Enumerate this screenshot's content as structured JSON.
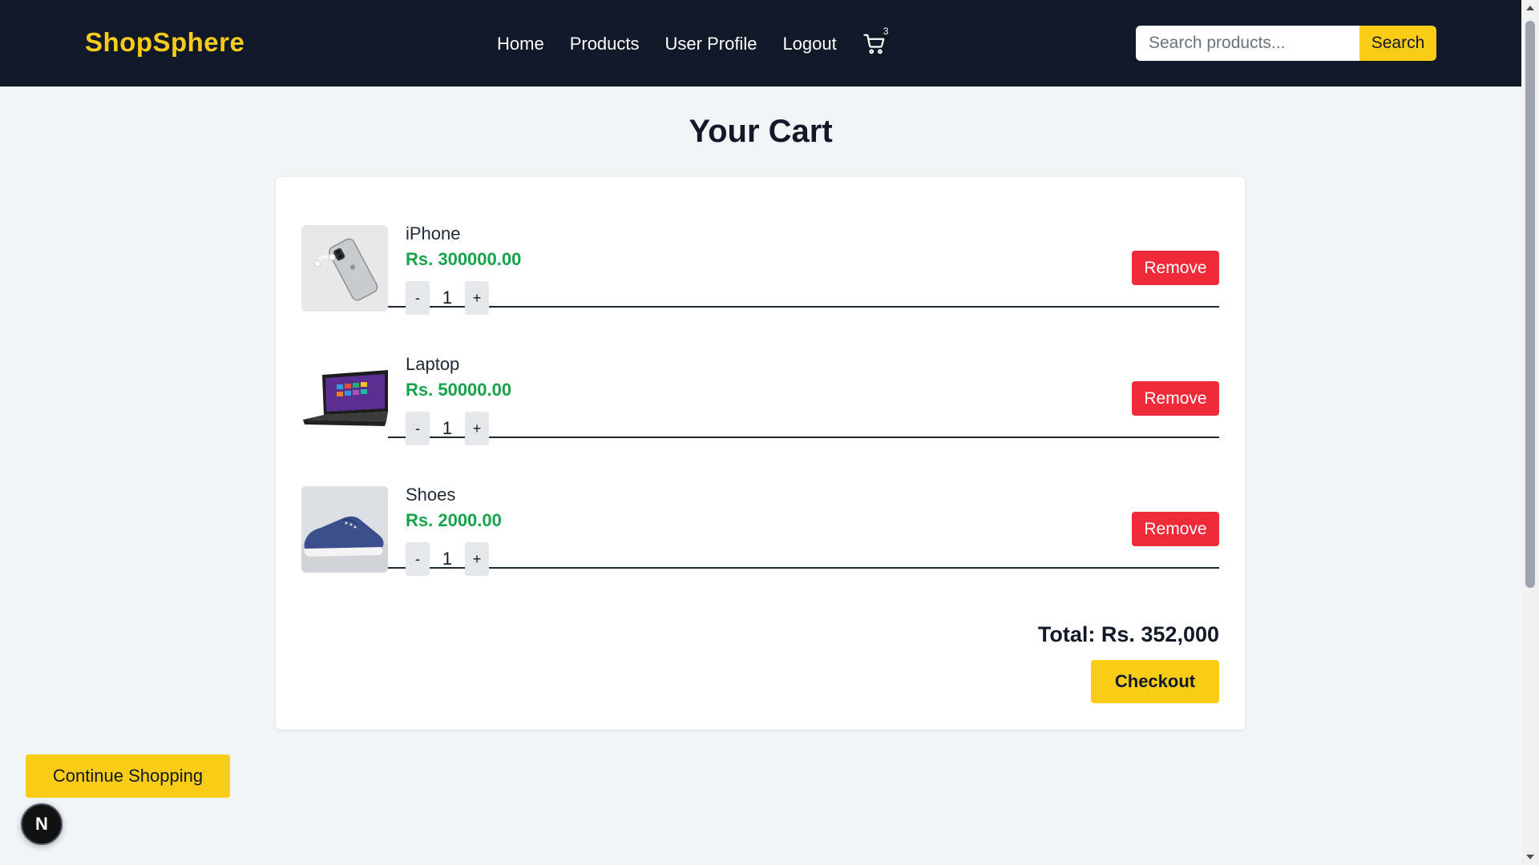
{
  "navbar": {
    "logo": "ShopSphere",
    "links": [
      "Home",
      "Products",
      "User Profile",
      "Logout"
    ],
    "cart_icon": "cart-icon",
    "cart_count": "3",
    "search": {
      "placeholder": "Search products...",
      "button_label": "Search"
    }
  },
  "page": {
    "title": "Your Cart",
    "items": [
      {
        "name": "iPhone",
        "price": "Rs. 300000.00",
        "quantity": "1",
        "image": "iphone-image",
        "minus": "-",
        "plus": "+",
        "remove_label": "Remove"
      },
      {
        "name": "Laptop",
        "price": "Rs. 50000.00",
        "quantity": "1",
        "image": "laptop-image",
        "minus": "-",
        "plus": "+",
        "remove_label": "Remove"
      },
      {
        "name": "Shoes",
        "price": "Rs. 2000.00",
        "quantity": "1",
        "image": "shoes-image",
        "minus": "-",
        "plus": "+",
        "remove_label": "Remove"
      }
    ],
    "total": "Total: Rs. 352,000",
    "checkout_label": "Checkout",
    "continue_label": "Continue Shopping"
  },
  "badge": {
    "letter": "N"
  },
  "colors": {
    "navbar_bg": "#111827",
    "brand_yellow": "#facc15",
    "price_green": "#16a34a",
    "remove_red": "#ef2b3a",
    "page_bg": "#f3f4f6"
  }
}
